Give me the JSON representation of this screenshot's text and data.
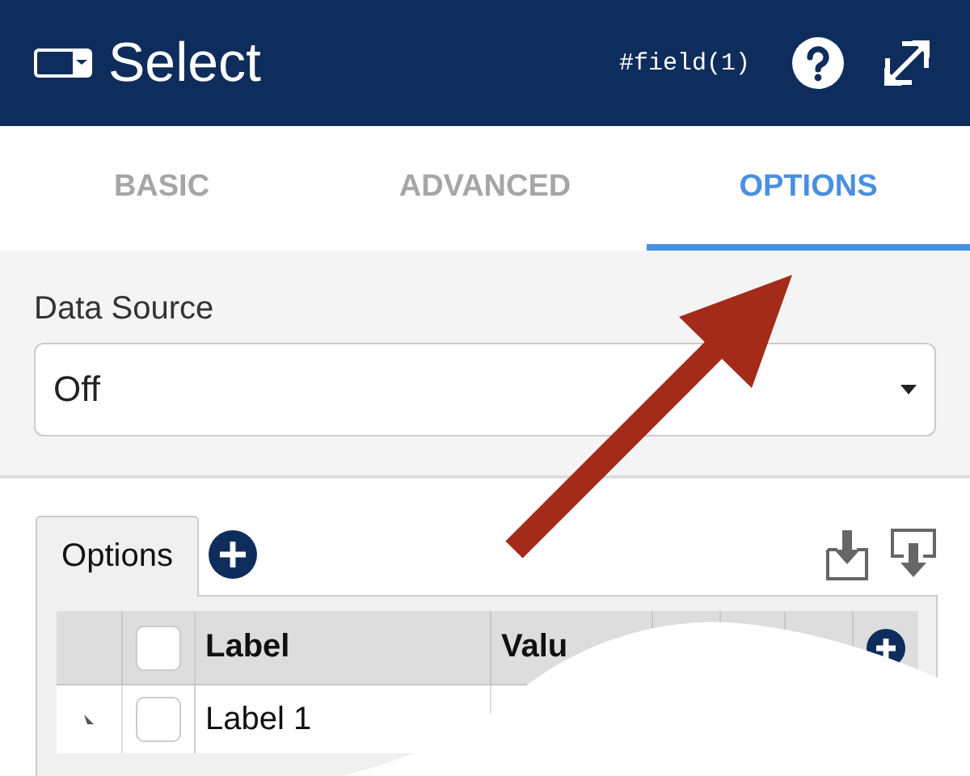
{
  "header": {
    "title": "Select",
    "field_id": "#field(1)"
  },
  "tabs": [
    {
      "label": "BASIC",
      "selected": false
    },
    {
      "label": "ADVANCED",
      "selected": false
    },
    {
      "label": "OPTIONS",
      "selected": true
    }
  ],
  "data_source": {
    "label": "Data Source",
    "value": "Off"
  },
  "options_tab": {
    "label": "Options"
  },
  "table": {
    "all_checked": false,
    "columns": [
      "Label",
      "Valu"
    ],
    "rows": [
      {
        "checked": false,
        "label": "Label 1"
      }
    ]
  }
}
